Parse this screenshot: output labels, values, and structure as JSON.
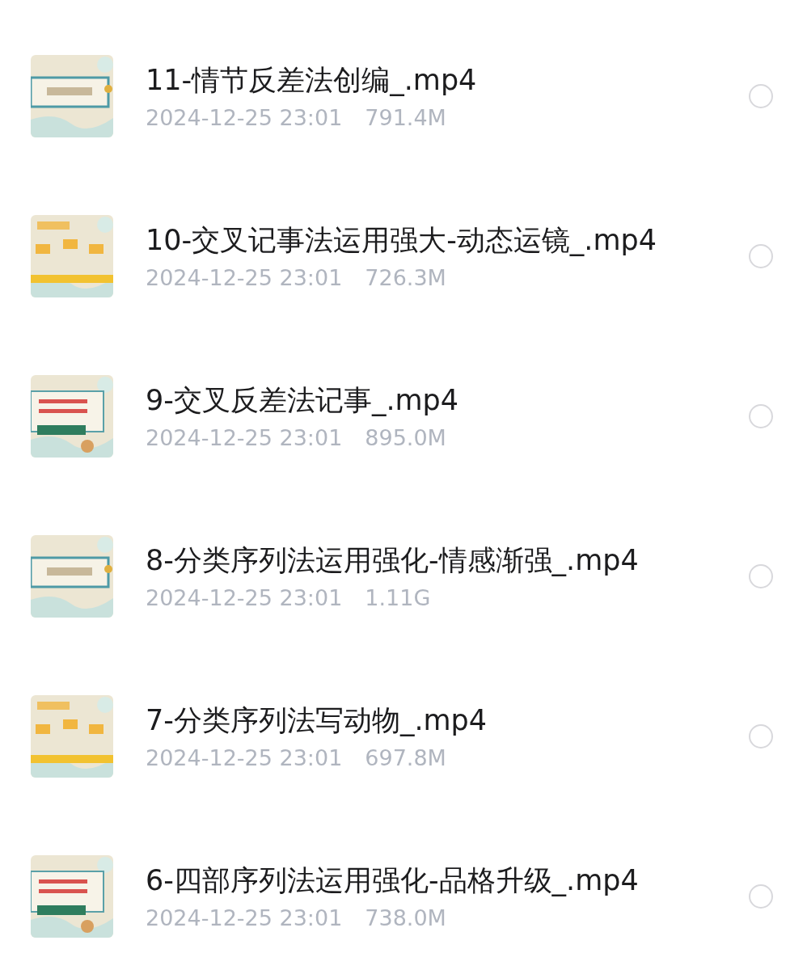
{
  "files": [
    {
      "name": "11-情节反差法创编_.mp4",
      "date": "2024-12-25 23:01",
      "size": "791.4M",
      "selected": false
    },
    {
      "name": "10-交叉记事法运用强大-动态运镜_.mp4",
      "date": "2024-12-25 23:01",
      "size": "726.3M",
      "selected": false
    },
    {
      "name": "9-交叉反差法记事_.mp4",
      "date": "2024-12-25 23:01",
      "size": "895.0M",
      "selected": false
    },
    {
      "name": "8-分类序列法运用强化-情感渐强_.mp4",
      "date": "2024-12-25 23:01",
      "size": "1.11G",
      "selected": false
    },
    {
      "name": "7-分类序列法写动物_.mp4",
      "date": "2024-12-25 23:01",
      "size": "697.8M",
      "selected": false
    },
    {
      "name": "6-四部序列法运用强化-品格升级_.mp4",
      "date": "2024-12-25 23:01",
      "size": "738.0M",
      "selected": false
    }
  ]
}
